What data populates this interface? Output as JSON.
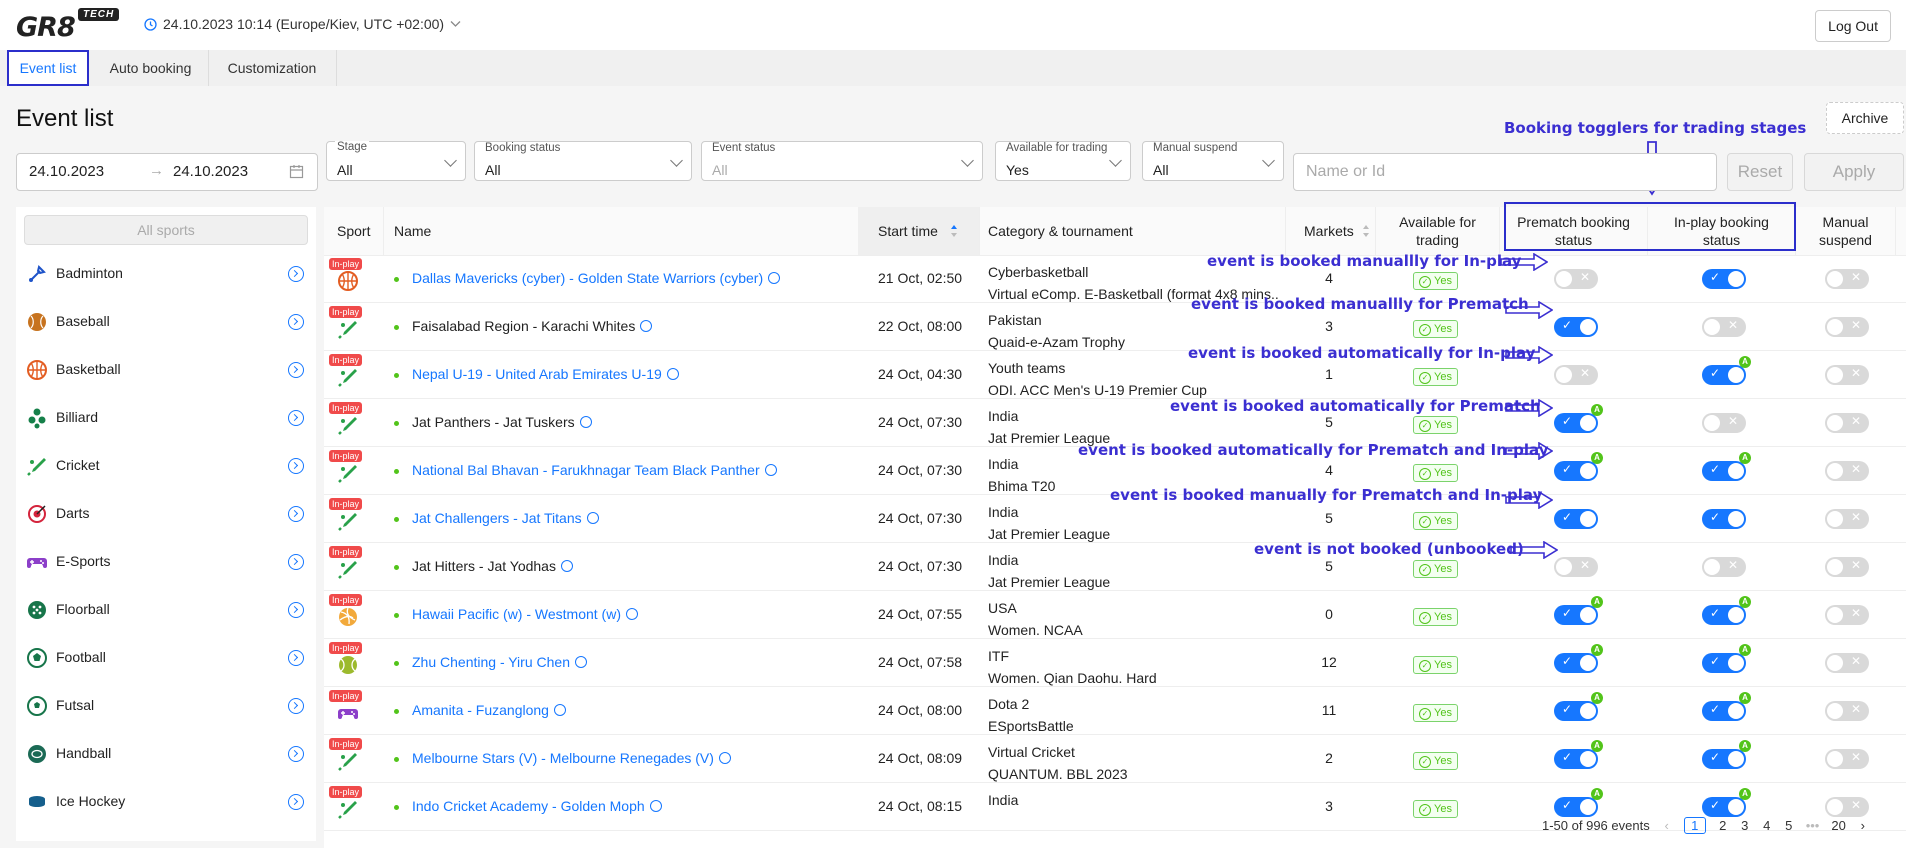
{
  "header": {
    "logo": "GR8",
    "logo_tag": "TECH",
    "datetime": "24.10.2023 10:14 (Europe/Kiev, UTC +02:00)",
    "logout": "Log Out"
  },
  "tabs": [
    "Event list",
    "Auto booking",
    "Customization"
  ],
  "page_title": "Event list",
  "archive": "Archive",
  "toggler_note": "Booking  togglers for trading stages",
  "filters": {
    "date_from": "24.10.2023",
    "date_to": "24.10.2023",
    "stage": {
      "label": "Stage",
      "value": "All"
    },
    "booking_status": {
      "label": "Booking status",
      "value": "All"
    },
    "event_status": {
      "label": "Event status",
      "value": "All"
    },
    "available_for_trading": {
      "label": "Available for trading",
      "value": "Yes"
    },
    "manual_suspend": {
      "label": "Manual suspend",
      "value": "All"
    },
    "search_placeholder": "Name or Id",
    "reset": "Reset",
    "apply": "Apply"
  },
  "sidebar": {
    "all_sports": "All sports",
    "items": [
      "Badminton",
      "Baseball",
      "Basketball",
      "Billiard",
      "Cricket",
      "Darts",
      "E-Sports",
      "Floorball",
      "Football",
      "Futsal",
      "Handball",
      "Ice Hockey"
    ]
  },
  "columns": {
    "sport": "Sport",
    "name": "Name",
    "start_time": "Start time",
    "category": "Category & tournament",
    "markets": "Markets",
    "available": "Available for trading",
    "prematch": "Prematch booking status",
    "inplay": "In-play booking status",
    "suspend": "Manual suspend"
  },
  "badge": "In-play",
  "yes_label": "Yes",
  "rows": [
    {
      "name": "Dallas Mavericks (cyber) - Golden State Warriors (cyber)",
      "link": true,
      "sport": "basketball",
      "time": "21 Oct, 02:50",
      "cat1": "Cyberbasketball",
      "cat2": "Virtual eComp. E-Basketball (format 4x8 mins...",
      "markets": "4",
      "pre": "off",
      "pre_auto": false,
      "inp": "on",
      "inp_auto": false
    },
    {
      "name": "Faisalabad Region - Karachi Whites",
      "link": false,
      "sport": "cricket",
      "time": "22 Oct, 08:00",
      "cat1": "Pakistan",
      "cat2": "Quaid-e-Azam Trophy",
      "markets": "3",
      "pre": "on",
      "pre_auto": false,
      "inp": "off",
      "inp_auto": false
    },
    {
      "name": "Nepal U-19 - United Arab Emirates U-19",
      "link": true,
      "sport": "cricket",
      "time": "24 Oct, 04:30",
      "cat1": "Youth teams",
      "cat2": "ODI. ACC Men's U-19 Premier Cup",
      "markets": "1",
      "pre": "off",
      "pre_auto": false,
      "inp": "on",
      "inp_auto": true
    },
    {
      "name": "Jat Panthers - Jat Tuskers",
      "link": false,
      "sport": "cricket",
      "time": "24 Oct, 07:30",
      "cat1": "India",
      "cat2": "Jat Premier League",
      "markets": "5",
      "pre": "on",
      "pre_auto": true,
      "inp": "off",
      "inp_auto": false
    },
    {
      "name": "National Bal Bhavan - Farukhnagar Team Black Panther",
      "link": true,
      "sport": "cricket",
      "time": "24 Oct, 07:30",
      "cat1": "India",
      "cat2": "Bhima T20",
      "markets": "4",
      "pre": "on",
      "pre_auto": true,
      "inp": "on",
      "inp_auto": true
    },
    {
      "name": "Jat Challengers - Jat Titans",
      "link": true,
      "sport": "cricket",
      "time": "24 Oct, 07:30",
      "cat1": "India",
      "cat2": "Jat Premier League",
      "markets": "5",
      "pre": "on",
      "pre_auto": false,
      "inp": "on",
      "inp_auto": false
    },
    {
      "name": "Jat Hitters - Jat Yodhas",
      "link": false,
      "sport": "cricket",
      "time": "24 Oct, 07:30",
      "cat1": "India",
      "cat2": "Jat Premier League",
      "markets": "5",
      "pre": "off",
      "pre_auto": false,
      "inp": "off",
      "inp_auto": false
    },
    {
      "name": "Hawaii Pacific (w) - Westmont (w)",
      "link": true,
      "sport": "volleyball",
      "time": "24 Oct, 07:55",
      "cat1": "USA",
      "cat2": "Women. NCAA",
      "markets": "0",
      "pre": "on",
      "pre_auto": true,
      "inp": "on",
      "inp_auto": true
    },
    {
      "name": "Zhu Chenting - Yiru Chen",
      "link": true,
      "sport": "tennis",
      "time": "24 Oct, 07:58",
      "cat1": "ITF",
      "cat2": "Women. Qian Daohu. Hard",
      "markets": "12",
      "pre": "on",
      "pre_auto": true,
      "inp": "on",
      "inp_auto": true
    },
    {
      "name": "Amanita - Fuzanglong",
      "link": true,
      "sport": "esports",
      "time": "24 Oct, 08:00",
      "cat1": "Dota 2",
      "cat2": "ESportsBattle",
      "markets": "11",
      "pre": "on",
      "pre_auto": true,
      "inp": "on",
      "inp_auto": true
    },
    {
      "name": "Melbourne Stars (V) - Melbourne Renegades (V)",
      "link": true,
      "sport": "cricket",
      "time": "24 Oct, 08:09",
      "cat1": "Virtual Cricket",
      "cat2": "QUANTUM. BBL 2023",
      "markets": "2",
      "pre": "on",
      "pre_auto": true,
      "inp": "on",
      "inp_auto": true
    },
    {
      "name": "Indo Cricket Academy - Golden Moph",
      "link": true,
      "sport": "cricket",
      "time": "24 Oct, 08:15",
      "cat1": "India",
      "cat2": "",
      "markets": "3",
      "pre": "on",
      "pre_auto": true,
      "inp": "on",
      "inp_auto": true
    }
  ],
  "annotations": [
    "event is booked manuallly for In-play",
    "event is booked manuallly for Prematch",
    "event is booked automatically for In-play",
    "event is booked automatically for Prematch",
    "event is booked automatically for Prematch and In-play",
    "event is booked manually for Prematch and In-play",
    "event is not booked (unbooked)"
  ],
  "pagination": {
    "summary": "1-50 of 996 events",
    "pages": [
      "1",
      "2",
      "3",
      "4",
      "5"
    ],
    "ellipsis": "•••",
    "last": "20"
  },
  "colors": {
    "accent": "#1677ff",
    "annotation": "#3b2fd1",
    "inplay_badge": "#f04a4a",
    "yes": "#52c41a"
  }
}
